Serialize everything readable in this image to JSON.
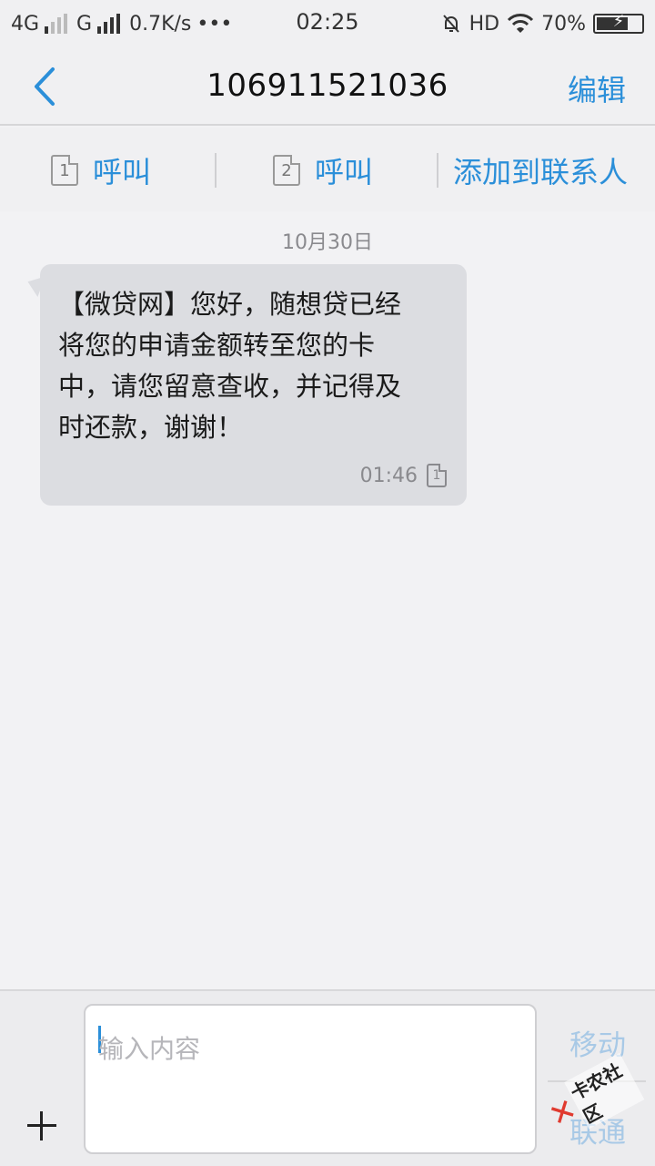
{
  "status_bar": {
    "net1": "4G",
    "net2": "G",
    "speed": "0.7K/s",
    "dots": "•••",
    "time": "02:25",
    "hd": "HD",
    "battery_pct": "70%",
    "battery_level": 0.7,
    "icons": [
      "signal-icon",
      "mute-alarm-icon",
      "wifi-icon",
      "battery-charging-icon"
    ]
  },
  "header": {
    "title": "106911521036",
    "edit": "编辑"
  },
  "actions": {
    "call1": {
      "sim": "1",
      "label": "呼叫"
    },
    "call2": {
      "sim": "2",
      "label": "呼叫"
    },
    "add_contact": "添加到联系人"
  },
  "conversation": {
    "date": "10月30日",
    "messages": [
      {
        "lines": [
          "【微贷网】您好，随想贷已经",
          "将您的申请金额转至您的卡",
          "中，请您留意查收，并记得及",
          "时还款，谢谢！"
        ],
        "time": "01:46",
        "sim": "1"
      }
    ]
  },
  "composer": {
    "placeholder": "输入内容",
    "send_mobile": "移动",
    "send_unicom": "联通"
  },
  "watermark": {
    "text": "卡农社区"
  },
  "colors": {
    "accent": "#2b8fd9",
    "bubble": "#dcdde1",
    "background": "#f2f2f4"
  }
}
